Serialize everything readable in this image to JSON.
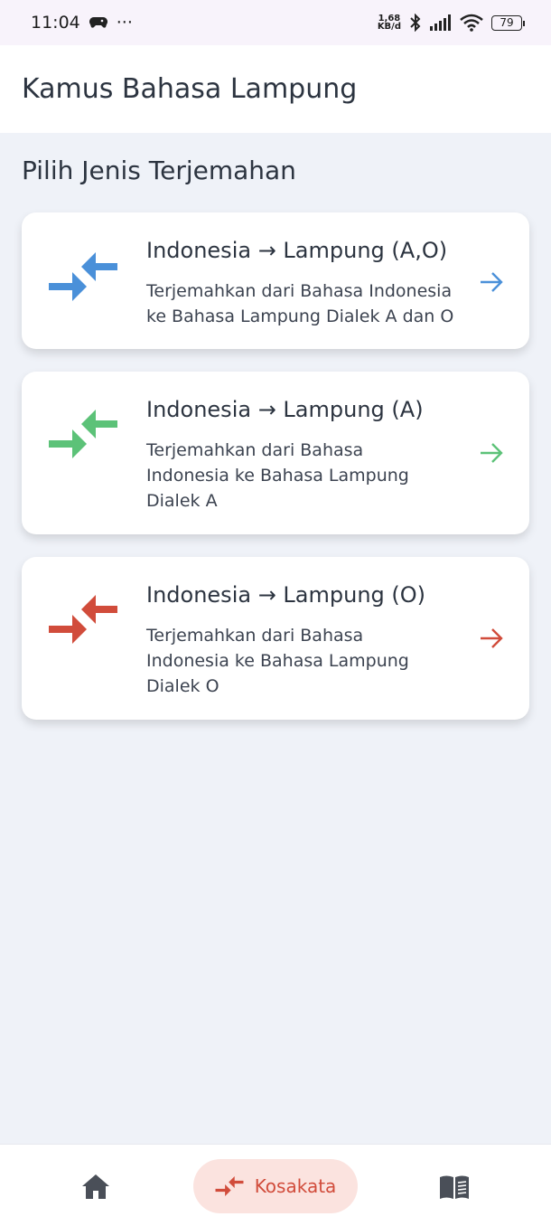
{
  "status_bar": {
    "time": "11:04",
    "more": "···",
    "net_speed_value": "1,68",
    "net_speed_unit": "KB/d",
    "battery": "79"
  },
  "app_bar": {
    "title": "Kamus Bahasa Lampung"
  },
  "section": {
    "title": "Pilih Jenis Terjemahan"
  },
  "cards": [
    {
      "title": "Indonesia → Lampung (A,O)",
      "description": "Terjemahkan dari Bahasa Indonesia ke Bahasa Lampung Dialek A dan O",
      "color": "#4a90d9",
      "icon": "swap-arrows-icon"
    },
    {
      "title": "Indonesia → Lampung (A)",
      "description": "Terjemahkan dari Bahasa Indonesia ke Bahasa Lampung Dialek A",
      "color": "#5cc278",
      "icon": "swap-arrows-icon"
    },
    {
      "title": "Indonesia → Lampung (O)",
      "description": "Terjemahkan dari Bahasa Indonesia ke Bahasa Lampung Dialek O",
      "color": "#d14c3b",
      "icon": "swap-arrows-icon"
    }
  ],
  "bottom_nav": {
    "items": [
      {
        "icon": "home-icon",
        "label": ""
      },
      {
        "icon": "swap-arrows-icon",
        "label": "Kosakata",
        "active": true,
        "color": "#d14c3b"
      },
      {
        "icon": "book-icon",
        "label": ""
      }
    ]
  }
}
